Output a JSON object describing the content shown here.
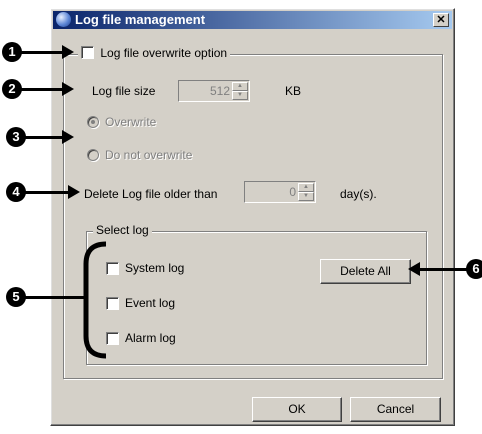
{
  "window": {
    "title": "Log file management",
    "icon": "globe-icon",
    "close_label": "✕"
  },
  "overwrite_option": {
    "label": "Log file overwrite option",
    "checked": false
  },
  "log_file_size": {
    "label": "Log file size",
    "value": "512",
    "unit": "KB"
  },
  "overwrite_radios": [
    {
      "label": "Overwrite",
      "selected": true,
      "enabled": false
    },
    {
      "label": "Do not overwrite",
      "selected": false,
      "enabled": false
    }
  ],
  "delete_older": {
    "label": "Delete Log file older than",
    "value": "0",
    "unit": "day(s)."
  },
  "select_log": {
    "group_label": "Select log",
    "items": [
      {
        "label": "System log",
        "checked": false
      },
      {
        "label": "Event log",
        "checked": false
      },
      {
        "label": "Alarm log",
        "checked": false
      }
    ],
    "delete_all_label": "Delete All"
  },
  "footer": {
    "ok_label": "OK",
    "cancel_label": "Cancel"
  },
  "callouts": [
    "1",
    "2",
    "3",
    "4",
    "5",
    "6"
  ],
  "colors": {
    "dialog_face": "#d4d0c8",
    "titlebar_start": "#0a246a",
    "titlebar_end": "#a6caf0",
    "disabled_text": "#808080"
  }
}
